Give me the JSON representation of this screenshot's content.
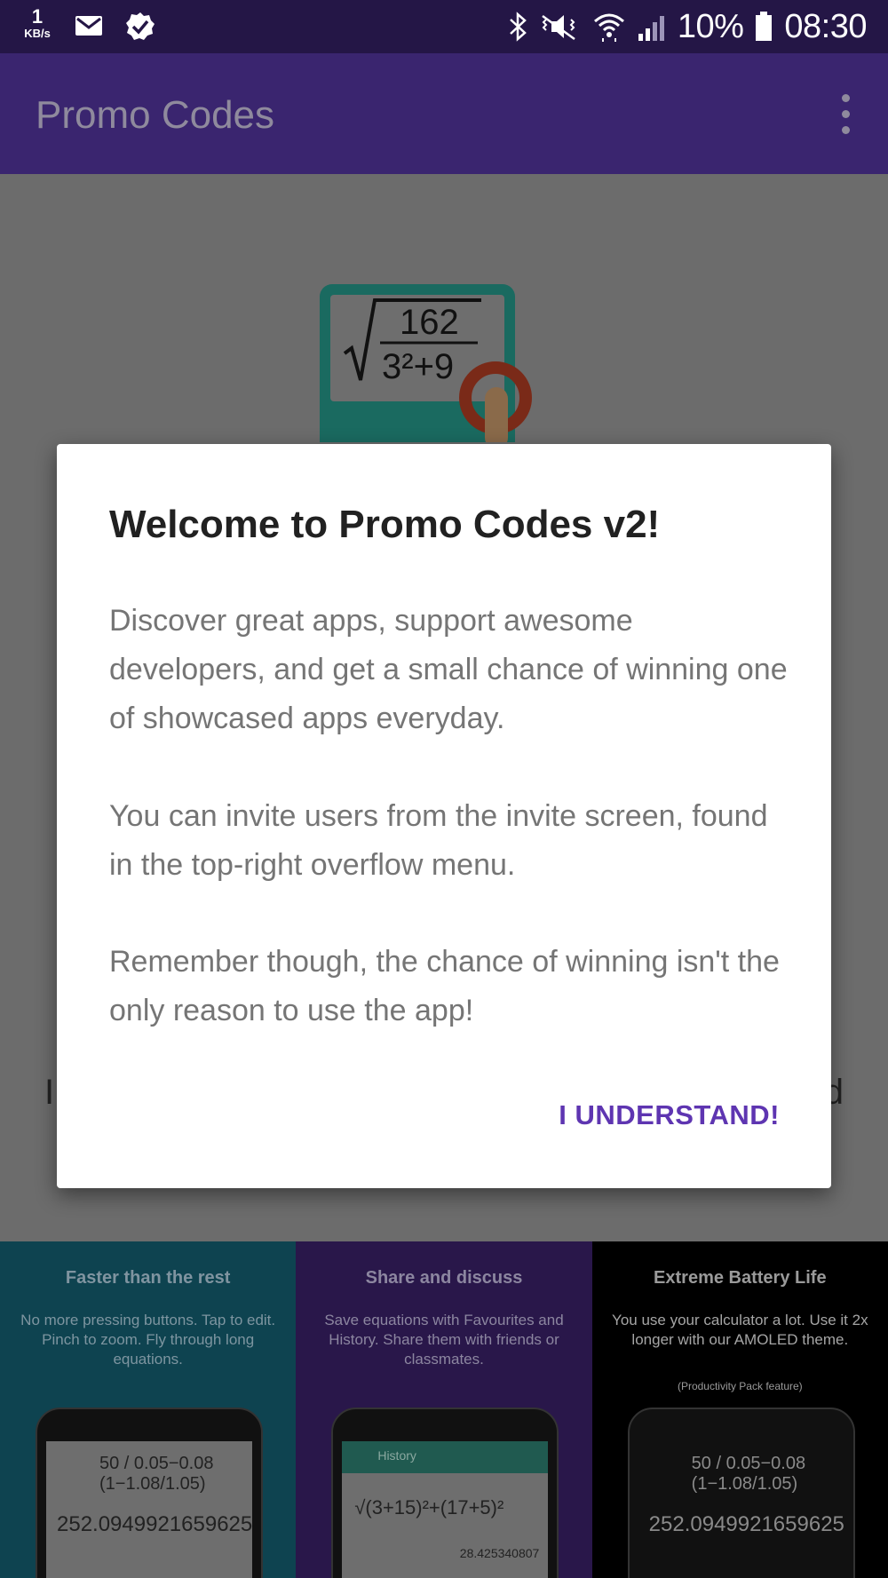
{
  "status_bar": {
    "net_speed": "1",
    "net_speed_unit": "KB/s",
    "icons": [
      "mail-icon",
      "check-badge-icon",
      "bluetooth-icon",
      "mute-icon",
      "wifi-icon",
      "signal-icon",
      "battery-icon"
    ],
    "battery": "10%",
    "time": "08:30"
  },
  "app_bar": {
    "title": "Promo Codes",
    "menu_icon": "overflow-menu-icon"
  },
  "hero": {
    "icon": "calculator-app-icon",
    "formula_numerator": "162",
    "formula_denominator": "3²+9"
  },
  "background_partial": {
    "left_char": "I",
    "right_char": "d"
  },
  "screenshots": [
    {
      "title": "Faster than the rest",
      "description": "No more pressing buttons. Tap to edit. Pinch to zoom. Fly through long equations.",
      "equation": "50 / 0.05−0.08 (1−1.08/1.05)",
      "result": "252.0949921659625"
    },
    {
      "title": "Share and discuss",
      "description": "Save equations with Favourites and History. Share them with friends or classmates.",
      "screen_title": "History",
      "equation": "√(3+15)²+(17+5)²",
      "result": "28.425340807"
    },
    {
      "title": "Extreme Battery Life",
      "description": "You use your calculator a lot. Use it 2x longer with our AMOLED theme.",
      "note": "(Productivity Pack feature)",
      "equation": "50 / 0.05−0.08 (1−1.08/1.05)",
      "result": "252.0949921659625"
    }
  ],
  "dialog": {
    "title": "Welcome to Promo Codes v2!",
    "paragraph_1": "Discover great apps, support awesome developers, and get a small chance of winning one of showcased apps everyday.",
    "paragraph_2": "You can invite users from the invite screen, found in the top-right overflow menu.",
    "paragraph_3": "Remember though, the chance of winning isn't the only reason to use the app!",
    "button_label": "I UNDERSTAND!"
  },
  "colors": {
    "status_bar": "#241646",
    "app_bar": "#3a256f",
    "accent": "#5e35b1",
    "dialog_bg": "#ffffff"
  }
}
